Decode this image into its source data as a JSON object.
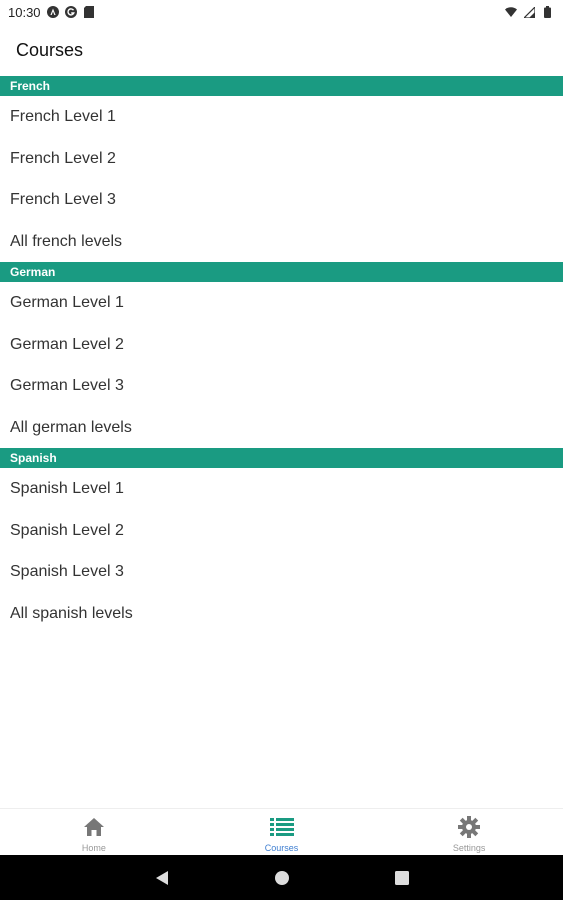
{
  "status_bar": {
    "time": "10:30",
    "left_icons": [
      "notification-a-icon",
      "notification-g-icon",
      "sd-card-icon"
    ],
    "right_icons": [
      "wifi-icon",
      "signal-icon",
      "battery-icon"
    ]
  },
  "app_bar": {
    "title": "Courses"
  },
  "sections": [
    {
      "header": "French",
      "items": [
        "French Level 1",
        "French Level 2",
        "French Level 3",
        "All french levels"
      ]
    },
    {
      "header": "German",
      "items": [
        "German Level 1",
        "German Level 2",
        "German Level 3",
        "All german levels"
      ]
    },
    {
      "header": "Spanish",
      "items": [
        "Spanish Level 1",
        "Spanish Level 2",
        "Spanish Level 3",
        "All spanish levels"
      ]
    }
  ],
  "bottom_nav": {
    "items": [
      {
        "label": "Home",
        "icon": "home-icon",
        "active": false
      },
      {
        "label": "Courses",
        "icon": "list-icon",
        "active": true
      },
      {
        "label": "Settings",
        "icon": "gear-icon",
        "active": false
      }
    ]
  },
  "colors": {
    "accent": "#1a9b82",
    "active_nav": "#3f7fd1",
    "inactive_nav": "#999999"
  }
}
